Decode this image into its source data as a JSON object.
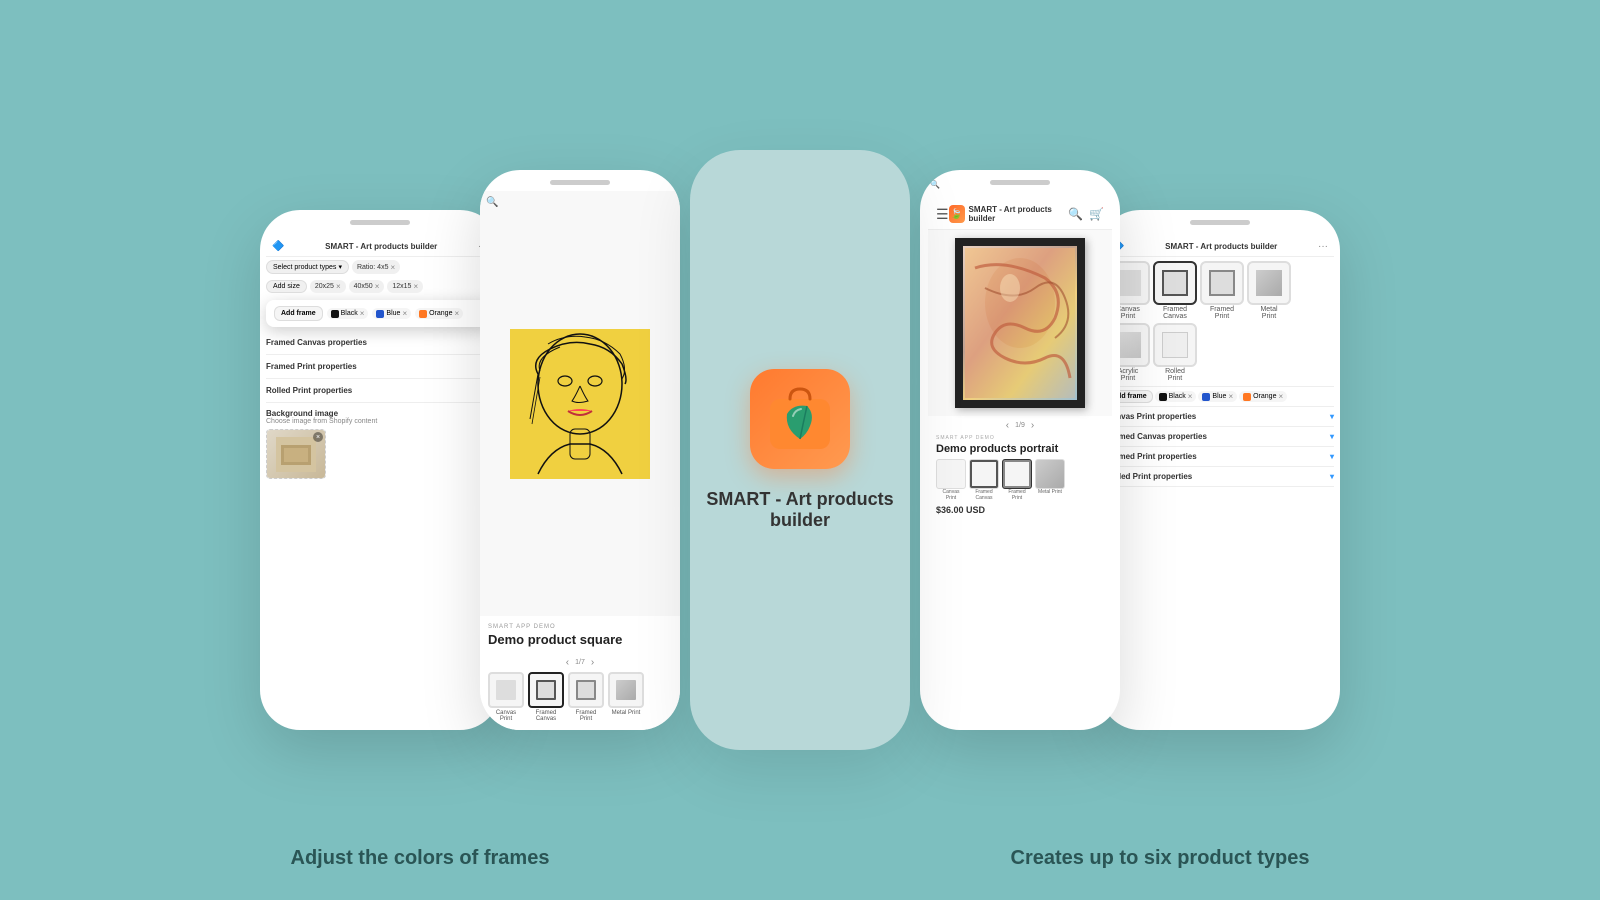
{
  "app": {
    "title": "SMART - Art products builder",
    "icon": "🍃"
  },
  "left_phone": {
    "title": "SMART - Art products builder",
    "select_product_types_label": "Select product types",
    "tags": [
      {
        "label": "Ratio: 4x5",
        "removable": true
      },
      {
        "label": "20x25",
        "removable": true
      },
      {
        "label": "40x50",
        "removable": true
      },
      {
        "label": "12x15",
        "removable": true
      }
    ],
    "add_size_label": "Add size",
    "frame_popup": {
      "add_frame_label": "Add frame",
      "colors": [
        {
          "label": "Black",
          "color": "#111"
        },
        {
          "label": "Blue",
          "color": "#2255cc"
        },
        {
          "label": "Orange",
          "color": "#ff7722"
        }
      ]
    },
    "properties": [
      {
        "label": "Framed Canvas properties",
        "expanded": false
      },
      {
        "label": "Framed Print properties",
        "expanded": false
      },
      {
        "label": "Rolled Print properties",
        "expanded": false
      }
    ],
    "bg_section": {
      "label": "Background image",
      "sublabel": "Choose image from Shopify content"
    }
  },
  "phone2": {
    "smart_demo_label": "SMART APP DEMO",
    "product_title": "Demo product square",
    "product_types": [
      {
        "label": "Canvas\nPrint",
        "selected": false
      },
      {
        "label": "Framed\nCanvas",
        "selected": true
      },
      {
        "label": "Framed\nPrint",
        "selected": false
      },
      {
        "label": "Metal Print",
        "selected": false
      }
    ],
    "pagination": {
      "current": 1,
      "total": 7
    }
  },
  "center": {
    "app_title": "SMART - Art products builder"
  },
  "phone3": {
    "smart_demo_label": "SMART APP DEMO",
    "product_title": "Demo products portrait",
    "price": "$36.00 USD",
    "product_types": [
      {
        "label": "Canvas\nPrint",
        "selected": false
      },
      {
        "label": "Framed\nCanvas",
        "selected": false
      },
      {
        "label": "Framed\nPrint",
        "selected": true
      },
      {
        "label": "Metal Print",
        "selected": false
      }
    ],
    "pagination": {
      "current": 1,
      "total": 9
    }
  },
  "right_phone": {
    "title": "SMART - Art products builder",
    "product_types": [
      {
        "label": "Canvas\nPrint",
        "selected": false
      },
      {
        "label": "Framed\nCanvas",
        "selected": true
      },
      {
        "label": "Framed\nPrint",
        "selected": false
      },
      {
        "label": "Metal\nPrint",
        "selected": false
      },
      {
        "label": "Acrylic\nPrint",
        "selected": false
      },
      {
        "label": "Rolled\nPrint",
        "selected": false
      }
    ],
    "frame_colors": [
      {
        "label": "Black",
        "color": "#111"
      },
      {
        "label": "Blue",
        "color": "#2255cc"
      },
      {
        "label": "Orange",
        "color": "#ff7722"
      }
    ],
    "add_frame_label": "Add frame",
    "properties": [
      {
        "label": "Canvas Print properties",
        "expanded": true
      },
      {
        "label": "Framed Canvas properties",
        "expanded": true
      },
      {
        "label": "Framed Print properties",
        "expanded": true
      },
      {
        "label": "Rolled Print properties",
        "expanded": true
      }
    ]
  },
  "captions": {
    "left": "Adjust the colors of  frames",
    "right": "Creates up to six product types"
  },
  "colors": {
    "background": "#7dbfbf",
    "accent_orange": "#ff7a2f",
    "selected_border": "#333",
    "text_dark": "#2a5555"
  }
}
